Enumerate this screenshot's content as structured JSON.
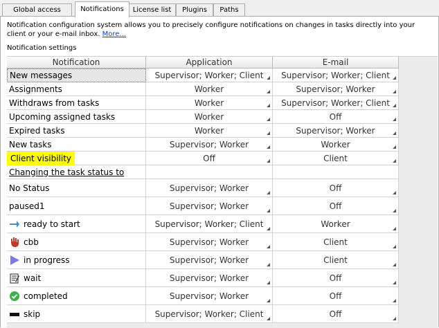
{
  "tabs": [
    {
      "label": "Global access rights",
      "active": false
    },
    {
      "label": "Notifications",
      "active": true
    },
    {
      "label": "License list",
      "active": false
    },
    {
      "label": "Plugins",
      "active": false
    },
    {
      "label": "Paths",
      "active": false
    }
  ],
  "description": {
    "text": "Notification configuration system allows you to precisely configure notifications on changes in tasks directly into your client or your e-mail inbox.",
    "more_link": "More..."
  },
  "settings_label": "Notification settings",
  "columns": [
    "Notification",
    "Application",
    "E-mail"
  ],
  "rows": [
    {
      "label": "New messages",
      "app": "Supervisor; Worker; Client",
      "email": "Supervisor; Worker; Client"
    },
    {
      "label": "Assignments",
      "app": "Worker",
      "email": "Supervisor; Worker"
    },
    {
      "label": "Withdraws from tasks",
      "app": "Worker",
      "email": "Supervisor; Worker; Client"
    },
    {
      "label": "Upcoming assigned tasks",
      "app": "Worker",
      "email": "Off"
    },
    {
      "label": "Expired tasks",
      "app": "Worker",
      "email": "Supervisor; Worker"
    },
    {
      "label": "New tasks",
      "app": "Supervisor; Worker",
      "email": "Worker"
    },
    {
      "label": "Client visibility",
      "app": "Off",
      "email": "Client"
    },
    {
      "label": "Changing the task status to",
      "app": "",
      "email": ""
    },
    {
      "label": "No Status",
      "app": "Supervisor; Worker",
      "email": "Off"
    },
    {
      "label": "paused1",
      "app": "Supervisor; Worker",
      "email": "Off"
    },
    {
      "label": "ready to start",
      "app": "Supervisor; Worker; Client",
      "email": "Worker",
      "icon": "arrow-right-icon"
    },
    {
      "label": "cbb",
      "app": "Supervisor; Worker",
      "email": "Client",
      "icon": "hand-stop-icon"
    },
    {
      "label": "in progress",
      "app": "Supervisor; Worker",
      "email": "Client",
      "icon": "play-triangle-icon"
    },
    {
      "label": "wait",
      "app": "Supervisor; Worker",
      "email": "Off",
      "icon": "clipboard-icon"
    },
    {
      "label": "completed",
      "app": "Supervisor; Worker",
      "email": "Off",
      "icon": "check-circle-icon"
    },
    {
      "label": "skip",
      "app": "Supervisor; Worker; Client",
      "email": "Off",
      "icon": "black-bar-icon"
    }
  ],
  "colors": {
    "highlight": "#ffff00",
    "link": "#0044cc",
    "icon_arrow": "#3a8fd8",
    "icon_hand": "#c0392b",
    "icon_play": "#7b7bdc",
    "icon_check": "#3cb04a"
  }
}
